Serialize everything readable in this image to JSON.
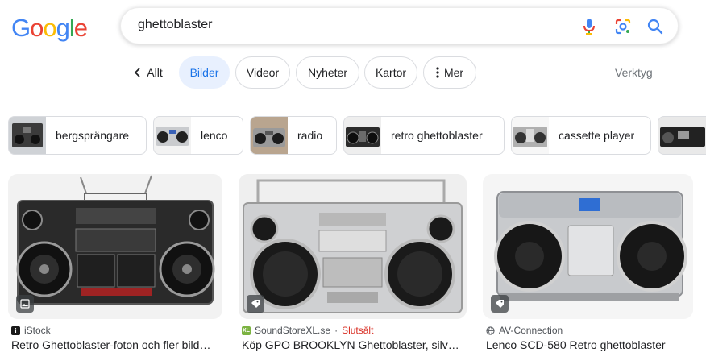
{
  "logo": {
    "letters": [
      "G",
      "o",
      "o",
      "g",
      "l",
      "e"
    ],
    "colors": [
      "#4285f4",
      "#ea4335",
      "#fbbc05",
      "#4285f4",
      "#34a853",
      "#ea4335"
    ]
  },
  "search": {
    "query": "ghettoblaster",
    "icons": [
      "microphone-icon",
      "lens-icon",
      "search-icon"
    ]
  },
  "tabs": {
    "back_icon": "chevron-left-icon",
    "items": [
      {
        "label": "Allt"
      },
      {
        "label": "Bilder",
        "active": true
      },
      {
        "label": "Videor"
      },
      {
        "label": "Nyheter"
      },
      {
        "label": "Kartor"
      },
      {
        "label": "Mer",
        "icon": "more-vertical-icon"
      }
    ],
    "tools": "Verktyg"
  },
  "chips": [
    {
      "label": "bergsprängare"
    },
    {
      "label": "lenco"
    },
    {
      "label": "radio"
    },
    {
      "label": "retro ghettoblaster"
    },
    {
      "label": "cassette player"
    }
  ],
  "results": [
    {
      "source": "iStock",
      "source_icon": "istock-favicon",
      "status": "",
      "title": "Retro Ghettoblaster-foton och fler bild…",
      "badge_icon": "image-icon"
    },
    {
      "source": "SoundStoreXL.se",
      "source_icon": "soundstorexl-favicon",
      "status": "Slutsålt",
      "title": "Köp GPO BROOKLYN Ghettoblaster, silver…",
      "badge_icon": "tag-icon"
    },
    {
      "source": "AV-Connection",
      "source_icon": "globe-icon",
      "status": "",
      "title": "Lenco SCD-580 Retro ghettoblaster",
      "badge_icon": "tag-icon"
    }
  ],
  "colors": {
    "accent": "#1a73e8",
    "active_tab_bg": "#e8f0fe",
    "sold": "#d93025"
  }
}
